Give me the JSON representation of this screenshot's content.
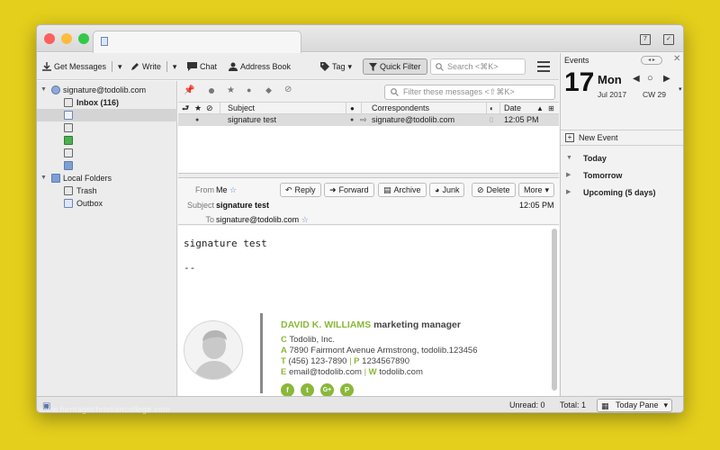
{
  "window": {
    "traffic_colors": [
      "#fc605c",
      "#fdbc40",
      "#34c84a"
    ]
  },
  "toolbar": {
    "get_messages": "Get Messages",
    "write": "Write",
    "chat": "Chat",
    "address_book": "Address Book",
    "tag": "Tag",
    "quick_filter": "Quick Filter",
    "search_placeholder": "Search <⌘K>"
  },
  "folders": {
    "account": "signature@todolib.com",
    "inbox": "Inbox (116)",
    "local_folders": "Local Folders",
    "trash": "Trash",
    "outbox": "Outbox"
  },
  "thread": {
    "filter_placeholder": "Filter these messages <⇧⌘K>",
    "columns": {
      "subject": "Subject",
      "correspondents": "Correspondents",
      "date": "Date"
    },
    "rows": [
      {
        "subject": "signature test",
        "correspondent": "signature@todolib.com",
        "date": "12:05 PM"
      }
    ]
  },
  "message": {
    "labels": {
      "from": "From",
      "subject": "Subject",
      "to": "To"
    },
    "from": "Me",
    "subject": "signature test",
    "to": "signature@todolib.com",
    "time": "12:05 PM",
    "actions": {
      "reply": "Reply",
      "forward": "Forward",
      "archive": "Archive",
      "junk": "Junk",
      "delete": "Delete",
      "more": "More"
    },
    "body_line1": "signature test",
    "body_line2": "--"
  },
  "signature": {
    "name": "DAVID K. WILLIAMS",
    "title": "marketing manager",
    "company": "Todolib, Inc.",
    "address": "7890 Fairmont Avenue Armstrong, todolib.123456",
    "phone": "(456) 123-7890",
    "fax": "1234567890",
    "email": "email@todolib.com",
    "web": "todolib.com",
    "letters": {
      "c": "C",
      "a": "A",
      "t": "T",
      "p": "P",
      "e": "E",
      "w": "W"
    },
    "social": [
      "f",
      "t",
      "G+",
      "P"
    ],
    "accent_color": "#8ab83a"
  },
  "events": {
    "title": "Events",
    "day": "17",
    "weekday": "Mon",
    "month_year": "Jul 2017",
    "week": "CW 29",
    "new_event": "New Event",
    "groups": [
      "Today",
      "Tomorrow",
      "Upcoming (5 days)"
    ]
  },
  "status": {
    "unread": "Unread: 0",
    "total": "Total: 1",
    "today_pane": "Today Pane"
  },
  "watermark": "www.heritagechristiancollege.com"
}
